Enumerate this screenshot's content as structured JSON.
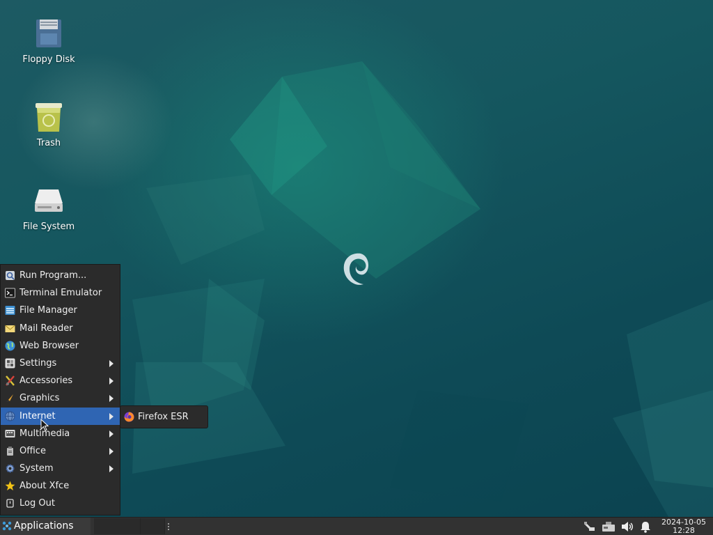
{
  "desktop": {
    "icons": [
      {
        "label": "Floppy Disk",
        "icon": "floppy-disk-icon"
      },
      {
        "label": "Trash",
        "icon": "trash-icon"
      },
      {
        "label": "File System",
        "icon": "hard-drive-icon"
      }
    ],
    "wallpaper": "debian-swirl"
  },
  "menu": {
    "items": [
      {
        "label": "Run Program...",
        "icon": "run-program-icon"
      },
      {
        "label": "Terminal Emulator",
        "icon": "terminal-icon"
      },
      {
        "label": "File Manager",
        "icon": "file-manager-icon"
      },
      {
        "label": "Mail Reader",
        "icon": "mail-icon"
      },
      {
        "label": "Web Browser",
        "icon": "globe-icon"
      },
      {
        "label": "Settings",
        "icon": "settings-icon",
        "submenu": true
      },
      {
        "label": "Accessories",
        "icon": "accessories-icon",
        "submenu": true
      },
      {
        "label": "Graphics",
        "icon": "graphics-icon",
        "submenu": true
      },
      {
        "label": "Internet",
        "icon": "internet-icon",
        "submenu": true,
        "active": true
      },
      {
        "label": "Multimedia",
        "icon": "multimedia-icon",
        "submenu": true
      },
      {
        "label": "Office",
        "icon": "office-icon",
        "submenu": true
      },
      {
        "label": "System",
        "icon": "system-gear-icon",
        "submenu": true
      },
      {
        "label": "About Xfce",
        "icon": "star-icon"
      },
      {
        "label": "Log Out",
        "icon": "log-out-icon"
      }
    ],
    "submenu_internet": [
      {
        "label": "Firefox ESR",
        "icon": "firefox-icon"
      }
    ]
  },
  "panel": {
    "applications_label": "Applications",
    "clock_date": "2024-10-05",
    "clock_time": "12:28",
    "tray": [
      "network-wired-icon",
      "power-adapter-icon",
      "volume-icon",
      "notification-bell-icon"
    ]
  },
  "colors": {
    "menu_bg": "#2b2b2b",
    "menu_highlight": "#2f65b3",
    "panel_bg": "#323232",
    "desktop_bg": "#15575f"
  }
}
